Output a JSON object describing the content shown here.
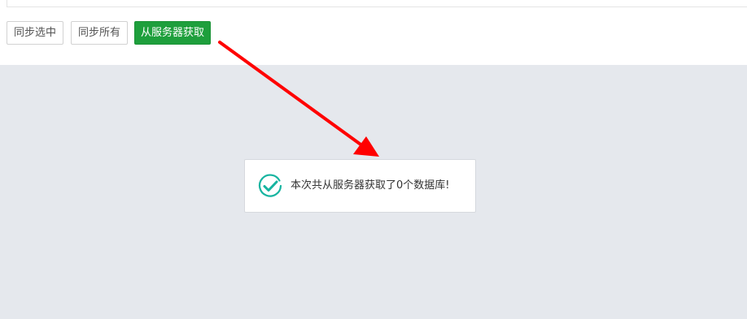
{
  "toolbar": {
    "sync_selected_label": "同步选中",
    "sync_all_label": "同步所有",
    "fetch_from_server_label": "从服务器获取"
  },
  "toast": {
    "message": "本次共从服务器获取了0个数据库!",
    "icon": "check-circle-icon"
  },
  "colors": {
    "primary_button": "#1e9f3c",
    "background_overlay": "#e5e8ed",
    "success_icon": "#16b4a0",
    "annotation_arrow": "#ff0000"
  }
}
